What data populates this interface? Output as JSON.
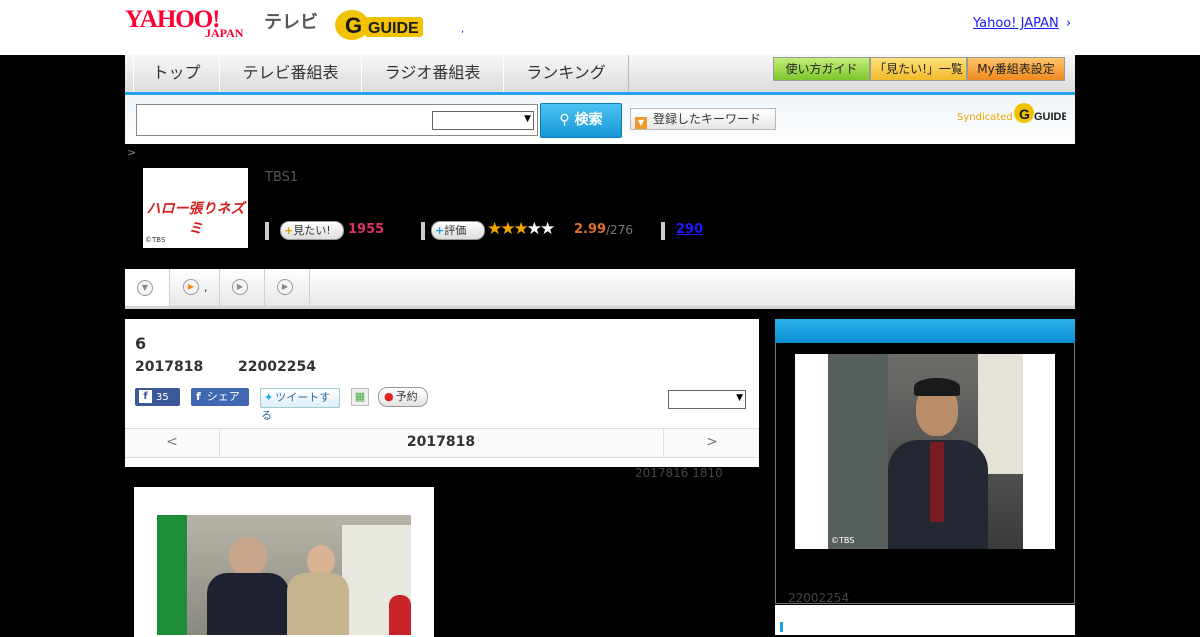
{
  "header": {
    "logo_yahoo": "YAHOO!",
    "logo_japan": "JAPAN",
    "logo_tv": "テレビ",
    "logo_gguide": "G-GUIDE",
    "yahoo_japan_link": "Yahoo! JAPAN",
    "link_arrow": "›",
    "dot": ","
  },
  "nav": {
    "tabs": [
      "トップ",
      "テレビ番組表",
      "ラジオ番組表",
      "ランキング"
    ],
    "guide_buttons": [
      "使い方ガイド",
      "「見たい!」一覧",
      "My番組表設定"
    ]
  },
  "search": {
    "input_value": "",
    "select_value": "",
    "search_button": "検索",
    "keyword_button": "登録したキーワード",
    "syndicated": "Syndicated",
    "syndicated_logo": "G-GUIDE"
  },
  "breadcrumb": ">",
  "program": {
    "thumb_title": "ハロー張りネズミ",
    "thumb_copyright": "©TBS",
    "station": "TBS1",
    "want_label": "見たい!",
    "want_count": "1955",
    "rate_label": "評価",
    "star_score": "2.99",
    "star_total": "/276",
    "comment_count": "290",
    "rating_value": 2.99,
    "rating_max": 5
  },
  "tabs_strip": {
    "items": [
      "",
      ",",
      "",
      ""
    ]
  },
  "episode": {
    "title": "6",
    "date": "2017818",
    "time": "22002254",
    "share_fb_count": "35",
    "share_label": "シェア",
    "tweet_label": "ツイートする",
    "reserve_label": "予約",
    "remind_select": ""
  },
  "date_nav": {
    "prev": "<",
    "current": "2017818",
    "next": ">"
  },
  "updated_text": "2017816  1810",
  "side": {
    "photo_copyright": "©TBS",
    "time": "22002254"
  },
  "colors": {
    "accent_blue": "#1fa3e6",
    "yahoo_red": "#ff0033",
    "want_pink": "#e0306a",
    "star_orange": "#e07030"
  }
}
